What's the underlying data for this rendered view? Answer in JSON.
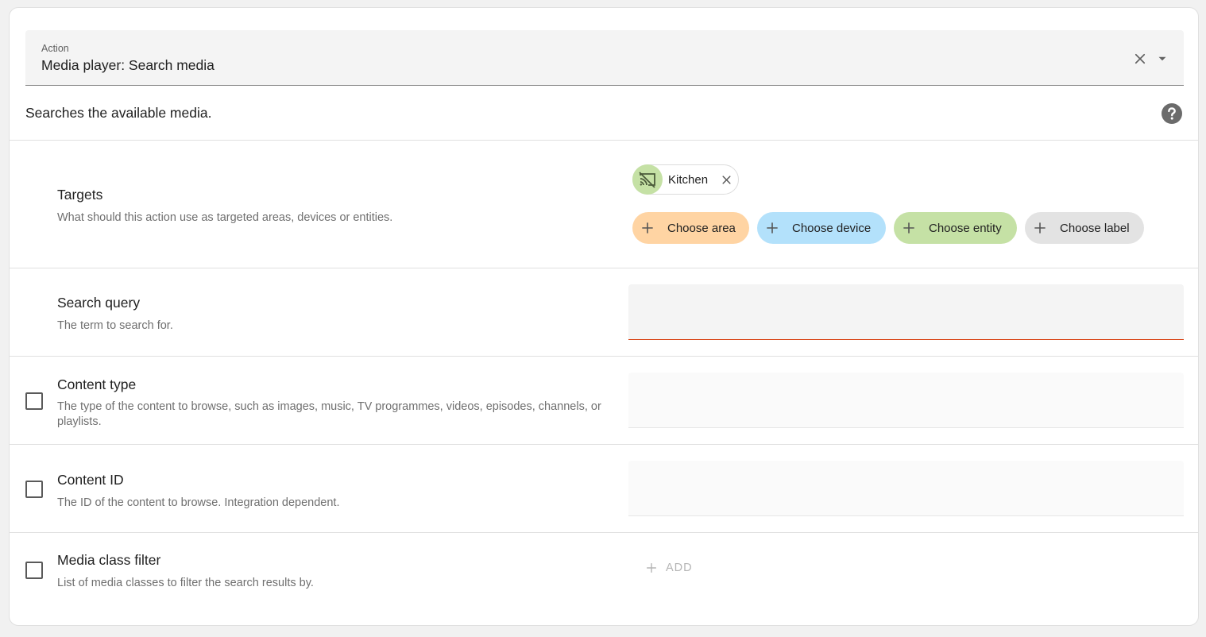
{
  "action": {
    "label": "Action",
    "value": "Media player: Search media"
  },
  "description": "Searches the available media.",
  "targets": {
    "title": "Targets",
    "description": "What should this action use as targeted areas, devices or entities.",
    "selected_chip": "Kitchen",
    "buttons": [
      {
        "label": "Choose area",
        "color": "#ffd4a3"
      },
      {
        "label": "Choose device",
        "color": "#b3e1fb"
      },
      {
        "label": "Choose entity",
        "color": "#c5e1a5"
      },
      {
        "label": "Choose label",
        "color": "#e3e3e3"
      }
    ]
  },
  "search_query": {
    "title": "Search query",
    "description": "The term to search for.",
    "value": ""
  },
  "content_type": {
    "title": "Content type",
    "description": "The type of the content to browse, such as images, music, TV programmes, videos, episodes, channels, or playlists.",
    "value": ""
  },
  "content_id": {
    "title": "Content ID",
    "description": "The ID of the content to browse. Integration dependent.",
    "value": ""
  },
  "media_class_filter": {
    "title": "Media class filter",
    "description": "List of media classes to filter the search results by.",
    "add_label": "ADD"
  },
  "colors": {
    "error_underline": "#d84315",
    "field_bg": "#f4f4f4",
    "disabled_field_bg": "#fafafa"
  }
}
